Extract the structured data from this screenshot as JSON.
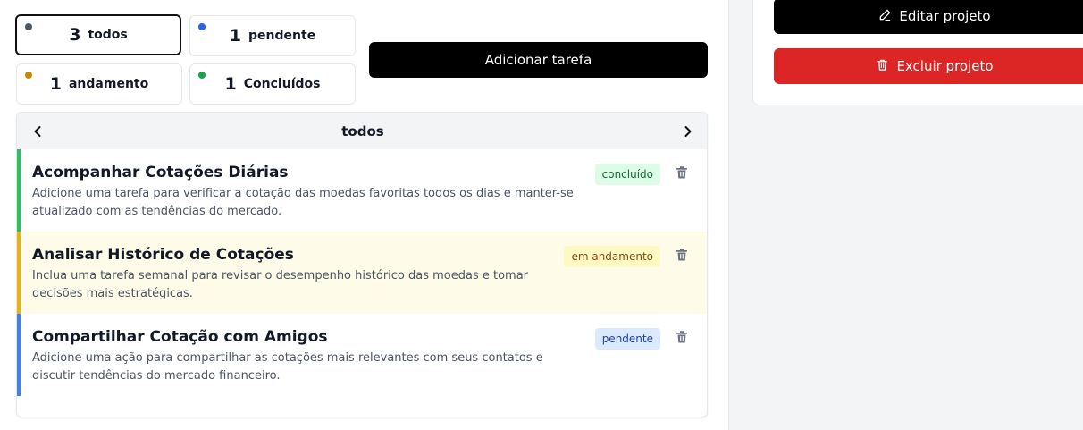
{
  "filters": [
    {
      "count": "3",
      "label": "todos",
      "dot_color": "#4b5563",
      "active": true
    },
    {
      "count": "1",
      "label": "pendente",
      "dot_color": "#2563eb",
      "active": false
    },
    {
      "count": "1",
      "label": "andamento",
      "dot_color": "#ca8a04",
      "active": false
    },
    {
      "count": "1",
      "label": "Concluídos",
      "dot_color": "#16a34a",
      "active": false
    }
  ],
  "add_task_label": "Adicionar tarefa",
  "panel": {
    "title": "todos",
    "prev_icon": "chevron-left-icon",
    "next_icon": "chevron-right-icon"
  },
  "tasks": [
    {
      "title": "Acompanhar Cotações Diárias",
      "description": "Adicione uma tarefa para verificar a cotação das moedas favoritas todos os dias e manter-se atualizado com as tendências do mercado.",
      "status": "concluído",
      "accent": "#22c55e",
      "bg": "#ffffff",
      "badge_bg": "#dcfce7",
      "badge_fg": "#166534"
    },
    {
      "title": "Analisar Histórico de Cotações",
      "description": "Inclua uma tarefa semanal para revisar o desempenho histórico das moedas e tomar decisões mais estratégicas.",
      "status": "em andamento",
      "accent": "#eab308",
      "bg": "#fefce8",
      "badge_bg": "#fef9c3",
      "badge_fg": "#854d0e"
    },
    {
      "title": "Compartilhar Cotação com Amigos",
      "description": "Adicione uma ação para compartilhar as cotações mais relevantes com seus contatos e discutir tendências do mercado financeiro.",
      "status": "pendente",
      "accent": "#3b82f6",
      "bg": "#ffffff",
      "badge_bg": "#dbeafe",
      "badge_fg": "#1e40af"
    }
  ],
  "project_actions": {
    "edit_label": "Editar projeto",
    "delete_label": "Excluir projeto",
    "edit_color": "#000000",
    "delete_color": "#dc2626"
  }
}
